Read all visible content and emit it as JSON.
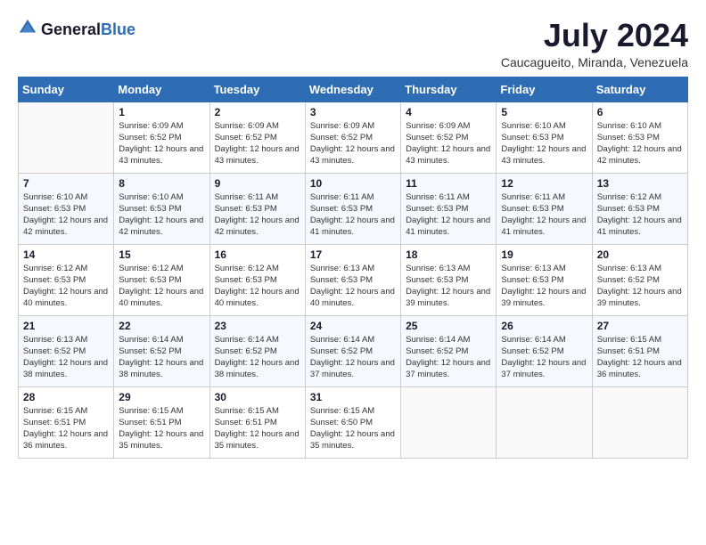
{
  "header": {
    "logo_general": "General",
    "logo_blue": "Blue",
    "month_year": "July 2024",
    "location": "Caucagueito, Miranda, Venezuela"
  },
  "weekdays": [
    "Sunday",
    "Monday",
    "Tuesday",
    "Wednesday",
    "Thursday",
    "Friday",
    "Saturday"
  ],
  "weeks": [
    [
      {
        "day": "",
        "empty": true
      },
      {
        "day": "1",
        "sunrise": "6:09 AM",
        "sunset": "6:52 PM",
        "daylight": "12 hours and 43 minutes."
      },
      {
        "day": "2",
        "sunrise": "6:09 AM",
        "sunset": "6:52 PM",
        "daylight": "12 hours and 43 minutes."
      },
      {
        "day": "3",
        "sunrise": "6:09 AM",
        "sunset": "6:52 PM",
        "daylight": "12 hours and 43 minutes."
      },
      {
        "day": "4",
        "sunrise": "6:09 AM",
        "sunset": "6:52 PM",
        "daylight": "12 hours and 43 minutes."
      },
      {
        "day": "5",
        "sunrise": "6:10 AM",
        "sunset": "6:53 PM",
        "daylight": "12 hours and 43 minutes."
      },
      {
        "day": "6",
        "sunrise": "6:10 AM",
        "sunset": "6:53 PM",
        "daylight": "12 hours and 42 minutes."
      }
    ],
    [
      {
        "day": "7",
        "sunrise": "6:10 AM",
        "sunset": "6:53 PM",
        "daylight": "12 hours and 42 minutes."
      },
      {
        "day": "8",
        "sunrise": "6:10 AM",
        "sunset": "6:53 PM",
        "daylight": "12 hours and 42 minutes."
      },
      {
        "day": "9",
        "sunrise": "6:11 AM",
        "sunset": "6:53 PM",
        "daylight": "12 hours and 42 minutes."
      },
      {
        "day": "10",
        "sunrise": "6:11 AM",
        "sunset": "6:53 PM",
        "daylight": "12 hours and 41 minutes."
      },
      {
        "day": "11",
        "sunrise": "6:11 AM",
        "sunset": "6:53 PM",
        "daylight": "12 hours and 41 minutes."
      },
      {
        "day": "12",
        "sunrise": "6:11 AM",
        "sunset": "6:53 PM",
        "daylight": "12 hours and 41 minutes."
      },
      {
        "day": "13",
        "sunrise": "6:12 AM",
        "sunset": "6:53 PM",
        "daylight": "12 hours and 41 minutes."
      }
    ],
    [
      {
        "day": "14",
        "sunrise": "6:12 AM",
        "sunset": "6:53 PM",
        "daylight": "12 hours and 40 minutes."
      },
      {
        "day": "15",
        "sunrise": "6:12 AM",
        "sunset": "6:53 PM",
        "daylight": "12 hours and 40 minutes."
      },
      {
        "day": "16",
        "sunrise": "6:12 AM",
        "sunset": "6:53 PM",
        "daylight": "12 hours and 40 minutes."
      },
      {
        "day": "17",
        "sunrise": "6:13 AM",
        "sunset": "6:53 PM",
        "daylight": "12 hours and 40 minutes."
      },
      {
        "day": "18",
        "sunrise": "6:13 AM",
        "sunset": "6:53 PM",
        "daylight": "12 hours and 39 minutes."
      },
      {
        "day": "19",
        "sunrise": "6:13 AM",
        "sunset": "6:53 PM",
        "daylight": "12 hours and 39 minutes."
      },
      {
        "day": "20",
        "sunrise": "6:13 AM",
        "sunset": "6:52 PM",
        "daylight": "12 hours and 39 minutes."
      }
    ],
    [
      {
        "day": "21",
        "sunrise": "6:13 AM",
        "sunset": "6:52 PM",
        "daylight": "12 hours and 38 minutes."
      },
      {
        "day": "22",
        "sunrise": "6:14 AM",
        "sunset": "6:52 PM",
        "daylight": "12 hours and 38 minutes."
      },
      {
        "day": "23",
        "sunrise": "6:14 AM",
        "sunset": "6:52 PM",
        "daylight": "12 hours and 38 minutes."
      },
      {
        "day": "24",
        "sunrise": "6:14 AM",
        "sunset": "6:52 PM",
        "daylight": "12 hours and 37 minutes."
      },
      {
        "day": "25",
        "sunrise": "6:14 AM",
        "sunset": "6:52 PM",
        "daylight": "12 hours and 37 minutes."
      },
      {
        "day": "26",
        "sunrise": "6:14 AM",
        "sunset": "6:52 PM",
        "daylight": "12 hours and 37 minutes."
      },
      {
        "day": "27",
        "sunrise": "6:15 AM",
        "sunset": "6:51 PM",
        "daylight": "12 hours and 36 minutes."
      }
    ],
    [
      {
        "day": "28",
        "sunrise": "6:15 AM",
        "sunset": "6:51 PM",
        "daylight": "12 hours and 36 minutes."
      },
      {
        "day": "29",
        "sunrise": "6:15 AM",
        "sunset": "6:51 PM",
        "daylight": "12 hours and 35 minutes."
      },
      {
        "day": "30",
        "sunrise": "6:15 AM",
        "sunset": "6:51 PM",
        "daylight": "12 hours and 35 minutes."
      },
      {
        "day": "31",
        "sunrise": "6:15 AM",
        "sunset": "6:50 PM",
        "daylight": "12 hours and 35 minutes."
      },
      {
        "day": "",
        "empty": true
      },
      {
        "day": "",
        "empty": true
      },
      {
        "day": "",
        "empty": true
      }
    ]
  ]
}
